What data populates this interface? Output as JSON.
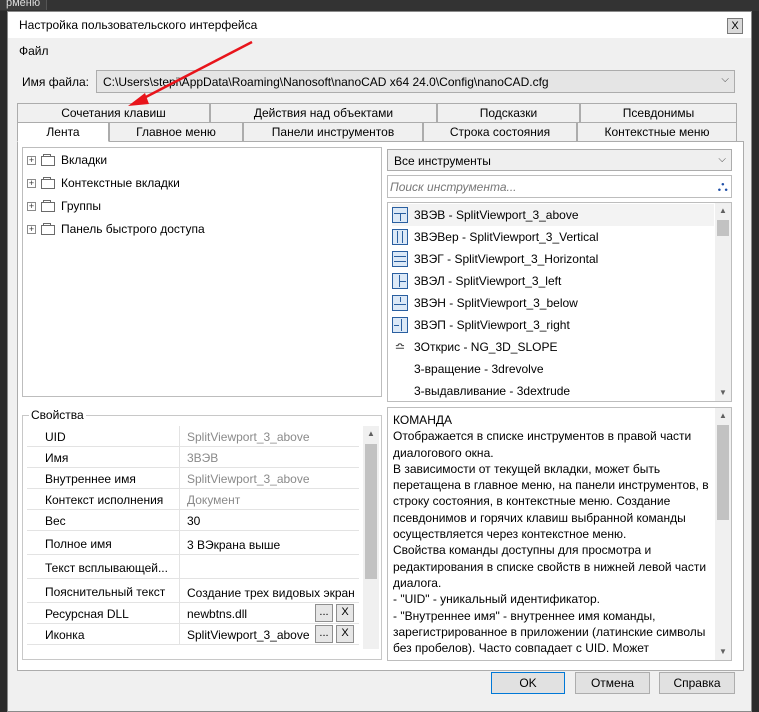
{
  "background": {
    "tab_label": "рменю"
  },
  "window": {
    "title": "Настройка пользовательского интерфейса",
    "close_label": "X"
  },
  "menu": {
    "file": "Файл"
  },
  "filename": {
    "label": "Имя файла:",
    "value": "C:\\Users\\stepi\\AppData\\Roaming\\Nanosoft\\nanoCAD x64 24.0\\Config\\nanoCAD.cfg"
  },
  "tabs_row1": [
    "Сочетания клавиш",
    "Действия над объектами",
    "Подсказки",
    "Псевдонимы"
  ],
  "tabs_row2": [
    "Лента",
    "Главное меню",
    "Панели инструментов",
    "Строка состояния",
    "Контекстные меню"
  ],
  "tree": [
    {
      "label": "Вкладки",
      "icon": "ribbon-tabs-icon"
    },
    {
      "label": "Контекстные вкладки",
      "icon": "context-tabs-icon"
    },
    {
      "label": "Группы",
      "icon": "groups-icon"
    },
    {
      "label": "Панель быстрого доступа",
      "icon": "quick-access-icon"
    }
  ],
  "tools": {
    "filter": "Все инструменты",
    "search_placeholder": "Поиск инструмента...",
    "items": [
      {
        "label": "3ВЭВ - SplitViewport_3_above",
        "icon": "split-above-icon"
      },
      {
        "label": "3ВЭВер - SplitViewport_3_Vertical",
        "icon": "split-vertical-icon"
      },
      {
        "label": "3ВЭГ - SplitViewport_3_Horizontal",
        "icon": "split-horizontal-icon"
      },
      {
        "label": "3ВЭЛ - SplitViewport_3_left",
        "icon": "split-left-icon"
      },
      {
        "label": "3ВЭН - SplitViewport_3_below",
        "icon": "split-below-icon"
      },
      {
        "label": "3ВЭП - SplitViewport_3_right",
        "icon": "split-right-icon"
      },
      {
        "label": "3Открис - NG_3D_SLOPE",
        "icon": "slope-icon"
      },
      {
        "label": "3-вращение - 3drevolve",
        "icon": ""
      },
      {
        "label": "3-выдавливание - 3dextrude",
        "icon": ""
      }
    ]
  },
  "properties": {
    "title": "Свойства",
    "rows": [
      {
        "key": "UID",
        "value": "SplitViewport_3_above",
        "gray": true
      },
      {
        "key": "Имя",
        "value": "3ВЭВ",
        "gray": true
      },
      {
        "key": "Внутреннее имя",
        "value": "SplitViewport_3_above",
        "gray": true
      },
      {
        "key": "Контекст исполнения",
        "value": "Документ",
        "gray": true
      },
      {
        "key": "Вес",
        "value": "30",
        "gray": false
      },
      {
        "key": "Полное имя",
        "value": "3 ВЭкрана выше",
        "gray": false
      },
      {
        "key": "Текст всплывающей...",
        "value": "",
        "gray": false
      },
      {
        "key": "Пояснительный текст",
        "value": "Создание трех видовых экран",
        "gray": false
      },
      {
        "key": "Ресурсная DLL",
        "value": "newbtns.dll",
        "gray": false
      },
      {
        "key": "Иконка",
        "value": "SplitViewport_3_above",
        "gray": false
      }
    ],
    "browse_label": "...",
    "clear_label": "X"
  },
  "description": {
    "lines": [
      "КОМАНДА",
      "Отображается в списке инструментов в правой части диалогового окна.",
      "В зависимости от текущей вкладки, может быть перетащена в главное меню, на панели инструментов, в строку состояния, в контекстные меню. Создание псевдонимов и горячих клавиш выбранной команды осуществляется через контекстное меню.",
      "Свойства команды доступны для просмотра и редактирования в списке свойств в нижней левой части диалога.",
      " - \"UID\" - уникальный идентификатор.",
      " - \"Внутреннее имя\" - внутреннее имя команды, зарегистрированное в приложении (латинские символы без пробелов). Часто совпадает с UID. Может"
    ]
  },
  "buttons": {
    "ok": "OK",
    "cancel": "Отмена",
    "help": "Справка"
  },
  "colors": {
    "accent": "#0078d7",
    "annotation_arrow": "#e8141b"
  }
}
